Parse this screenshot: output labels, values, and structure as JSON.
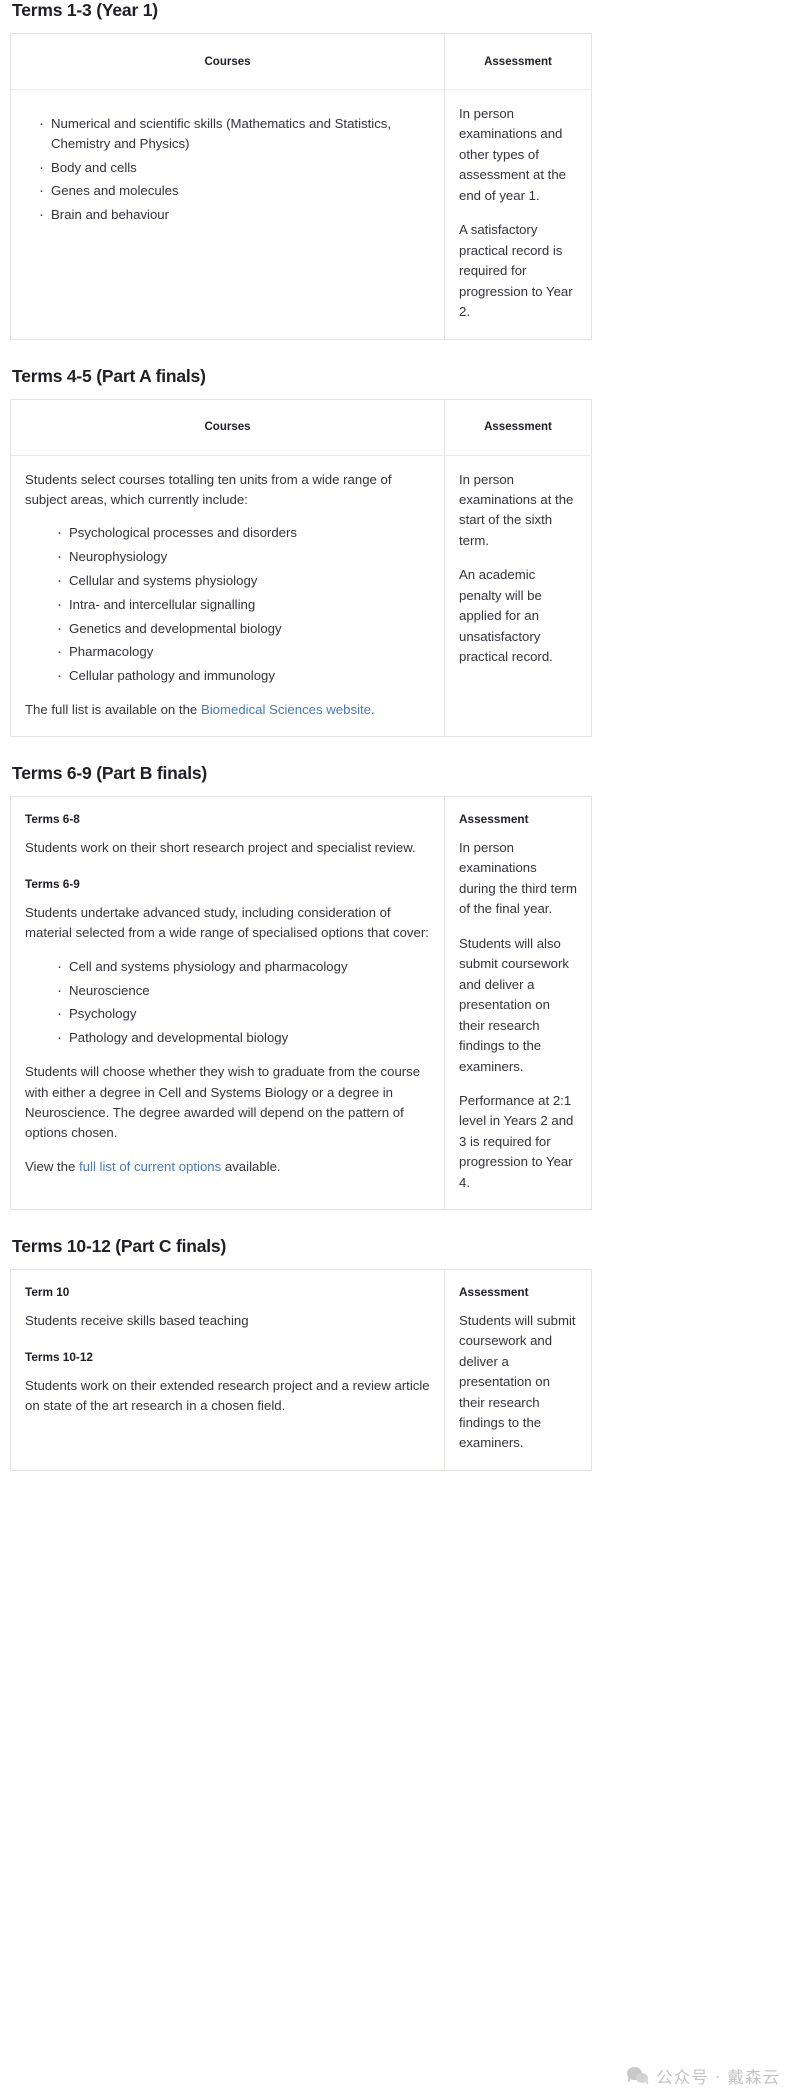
{
  "colors": {
    "link": "#4a79b5",
    "text": "#33333b",
    "heading": "#1f1f26",
    "border": "#e3e3e0",
    "watermark": "#c4c4c4"
  },
  "columns": {
    "courses": "Courses",
    "assessment": "Assessment"
  },
  "sections": [
    {
      "title": "Terms 1-3 (Year 1)",
      "header_style": "column-headers",
      "courses": {
        "bullets": [
          "Numerical and scientific skills (Mathematics and Statistics, Chemistry and Physics)",
          "Body and cells",
          "Genes and molecules",
          "Brain and behaviour"
        ]
      },
      "assessment": {
        "paragraphs": [
          "In person examinations and other types of assessment at the end of year 1.",
          "A satisfactory practical record is required for progression to Year 2."
        ]
      }
    },
    {
      "title": "Terms 4-5 (Part A finals)",
      "header_style": "column-headers",
      "courses": {
        "intro": "Students select courses totalling ten units from a wide range of subject areas, which currently include:",
        "bullets": [
          "Psychological processes and disorders",
          "Neurophysiology",
          "Cellular and systems physiology",
          "Intra- and intercellular signalling",
          "Genetics and developmental biology",
          "Pharmacology",
          "Cellular pathology and immunology"
        ],
        "outro_prefix": "The full list is available on the ",
        "outro_link": "Biomedical Sciences website",
        "outro_suffix": "."
      },
      "assessment": {
        "paragraphs": [
          "In person examinations at the start of the sixth term.",
          "An academic penalty will be applied for an unsatisfactory practical record."
        ]
      }
    },
    {
      "title": "Terms 6-9 (Part B finals)",
      "header_style": "inline-headers",
      "courses": {
        "blocks": [
          {
            "heading": "Terms 6-8",
            "paragraph": "Students work on their short research project and specialist review."
          },
          {
            "heading": "Terms 6-9",
            "paragraph": "Students undertake advanced study, including consideration of material selected from a wide range of specialised options that cover:",
            "bullets": [
              "Cell and systems physiology and pharmacology",
              "Neuroscience",
              "Psychology",
              "Pathology and developmental biology"
            ],
            "paragraph_after": "Students will choose whether they wish to graduate from the course with either a degree in Cell and Systems Biology or a degree in Neuroscience. The degree awarded will depend on the pattern of options chosen.",
            "link_prefix": "View the ",
            "link_text": "full list of current options",
            "link_suffix": " available."
          }
        ]
      },
      "assessment": {
        "heading": "Assessment",
        "paragraphs": [
          "In person examinations during the third term of the final year.",
          "Students will also submit coursework and deliver a presentation on their research findings to the examiners.",
          "Performance at 2:1 level in Years 2 and 3 is required for progression to Year 4."
        ]
      }
    },
    {
      "title": "Terms 10-12 (Part C finals)",
      "header_style": "inline-headers",
      "courses": {
        "blocks": [
          {
            "heading": "Term 10",
            "paragraph": "Students receive skills based teaching"
          },
          {
            "heading": "Terms 10-12",
            "paragraph": "Students work on their extended research project and a review article on state of the art research in a chosen field."
          }
        ]
      },
      "assessment": {
        "heading": "Assessment",
        "paragraphs": [
          "Students will submit coursework and deliver a presentation on their research findings to the examiners."
        ]
      }
    }
  ],
  "watermark": {
    "text": "公众号 · 戴森云",
    "icon": "wechat-icon"
  }
}
